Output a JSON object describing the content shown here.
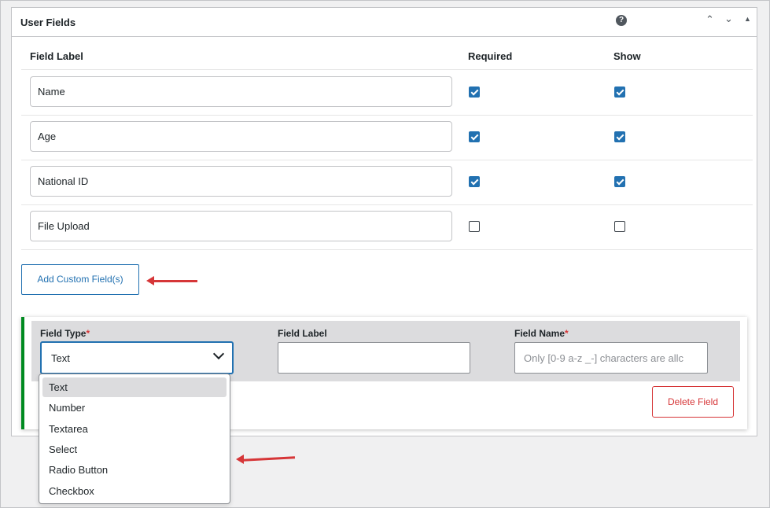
{
  "panel": {
    "title": "User Fields",
    "help_icon": "?",
    "controls": [
      "chevron-up-icon",
      "chevron-down-icon",
      "triangle-up-icon"
    ]
  },
  "table": {
    "headers": {
      "label": "Field Label",
      "required": "Required",
      "show": "Show"
    },
    "rows": [
      {
        "label": "Name",
        "required": true,
        "show": true
      },
      {
        "label": "Age",
        "required": true,
        "show": true
      },
      {
        "label": "National ID",
        "required": true,
        "show": true
      },
      {
        "label": "File Upload",
        "required": false,
        "show": false
      }
    ]
  },
  "add_button": "Add Custom Field(s)",
  "custom_field": {
    "type_label": "Field Type",
    "label_label": "Field Label",
    "name_label": "Field Name",
    "required_marker": "*",
    "type_value": "Text",
    "label_value": "",
    "name_placeholder": "Only [0-9 a-z _-] characters are allc",
    "delete_button": "Delete Field"
  },
  "dropdown": {
    "options": [
      "Text",
      "Number",
      "Textarea",
      "Select",
      "Radio Button",
      "Checkbox"
    ],
    "selected": "Text"
  },
  "colors": {
    "accent": "#2271b1",
    "danger": "#d63638",
    "success_border": "#008a20",
    "annotation_arrow": "#d63638"
  }
}
